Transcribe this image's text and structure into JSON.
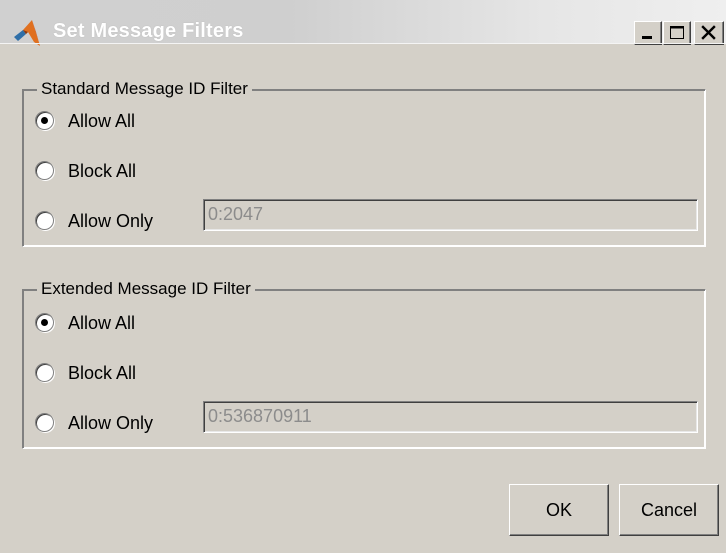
{
  "window": {
    "title": "Set Message Filters",
    "icon": "matlab-logo-icon",
    "controls": [
      "minimize-icon",
      "maximize-icon",
      "close-icon"
    ]
  },
  "standard_filter": {
    "label": "Standard Message ID Filter",
    "options": [
      {
        "label": "Allow All",
        "selected": true
      },
      {
        "label": "Block All",
        "selected": false
      },
      {
        "label": "Allow Only",
        "selected": false
      }
    ],
    "allow_only_value": "0:2047"
  },
  "extended_filter": {
    "label": "Extended Message ID Filter",
    "options": [
      {
        "label": "Allow All",
        "selected": true
      },
      {
        "label": "Block All",
        "selected": false
      },
      {
        "label": "Allow Only",
        "selected": false
      }
    ],
    "allow_only_value": "0:536870911"
  },
  "buttons": {
    "ok": "OK",
    "cancel": "Cancel"
  },
  "colors": {
    "dialog_bg": "#d4d0c8",
    "disabled_text": "#8c8c8c"
  }
}
